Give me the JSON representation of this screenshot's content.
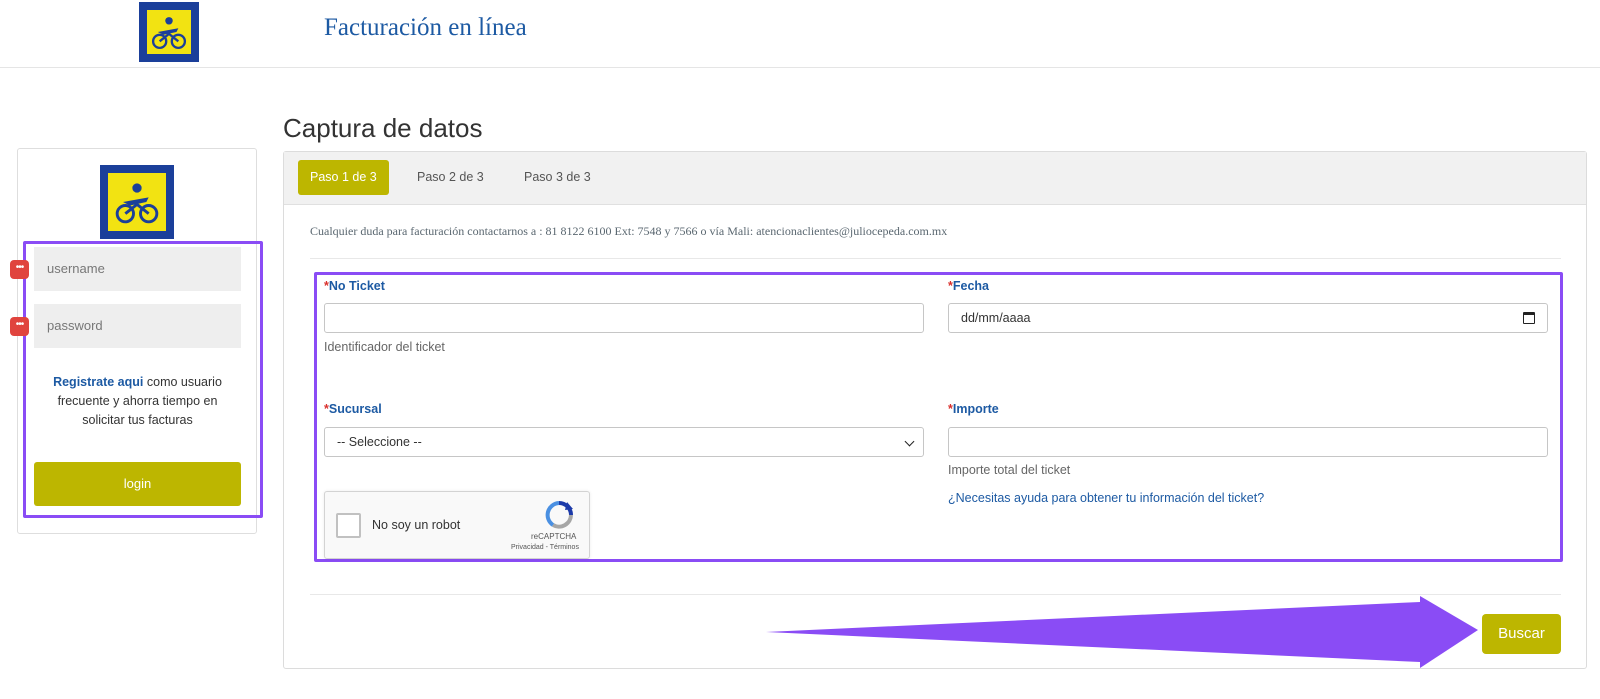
{
  "header": {
    "logo_icon": "julio-cepeda-logo",
    "title": "Facturación en línea"
  },
  "login": {
    "logo_icon": "julio-cepeda-logo",
    "username_placeholder": "username",
    "password_placeholder": "password",
    "password_manager_icon": "password-manager-icon",
    "register_link": "Registrate aqui",
    "register_text_rest": " como usuario frecuente y ahorra tiempo en solicitar tus facturas",
    "login_button": "login"
  },
  "main": {
    "heading": "Captura de datos",
    "tabs": [
      {
        "label": "Paso 1 de 3",
        "active": true
      },
      {
        "label": "Paso 2 de 3",
        "active": false
      },
      {
        "label": "Paso 3 de 3",
        "active": false
      }
    ],
    "contact_text": "Cualquier duda para facturación contactarnos a : 81 8122 6100 Ext: 7548 y 7566 o vía Mali: atencionaclientes@juliocepeda.com.mx",
    "fields": {
      "no_ticket": {
        "required_mark": "*",
        "label": "No Ticket",
        "value": "",
        "help": "Identificador del ticket"
      },
      "fecha": {
        "required_mark": "*",
        "label": "Fecha",
        "placeholder": "dd/mm/aaaa",
        "icon": "calendar-icon"
      },
      "sucursal": {
        "required_mark": "*",
        "label": "Sucursal",
        "selected": "-- Seleccione --"
      },
      "importe": {
        "required_mark": "*",
        "label": "Importe",
        "value": "",
        "help": "Importe total del ticket"
      }
    },
    "ticket_help_link": "¿Necesitas ayuda para obtener tu información del ticket?",
    "recaptcha": {
      "label": "No soy un robot",
      "brand": "reCAPTCHA",
      "terms": "Privacidad - Términos"
    },
    "search_button": "Buscar"
  },
  "annotations": {
    "highlight_color": "#8a4cf5",
    "accent_color": "#bdb600",
    "link_color": "#1d5aa3"
  }
}
